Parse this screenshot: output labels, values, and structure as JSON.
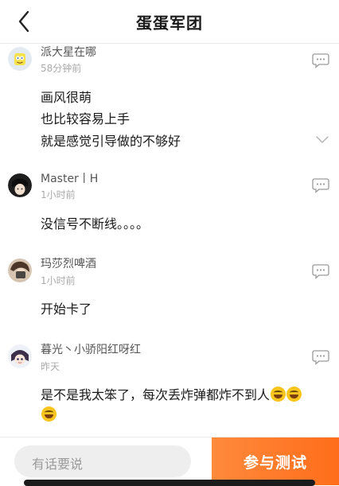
{
  "header": {
    "title": "蛋蛋军团",
    "back_icon": "chevron-left-icon"
  },
  "comments": [
    {
      "username": "派大星在哪",
      "time": "58分钟前",
      "lines": [
        "画风很萌",
        "也比较容易上手",
        "就是感觉引导做的不够好"
      ],
      "expandable": true
    },
    {
      "username": "Master丨H",
      "time": "1小时前",
      "lines": [
        "没信号不断线。。。。"
      ]
    },
    {
      "username": "玛莎烈啤酒",
      "time": "1小时前",
      "lines": [
        "开始卡了"
      ]
    },
    {
      "username": "暮光丶小骄阳红呀红",
      "time": "昨天",
      "lines": [
        "是不是我太笨了，每次丢炸弹都炸不到人"
      ],
      "emoji": "tears-of-joy-emoji"
    }
  ],
  "bottom_bar": {
    "input_placeholder": "有话要说",
    "join_button_label": "参与测试"
  },
  "colors": {
    "accent": "#ff7a2a",
    "text_primary": "#1a1a1a",
    "text_secondary": "#aaaaaa"
  }
}
